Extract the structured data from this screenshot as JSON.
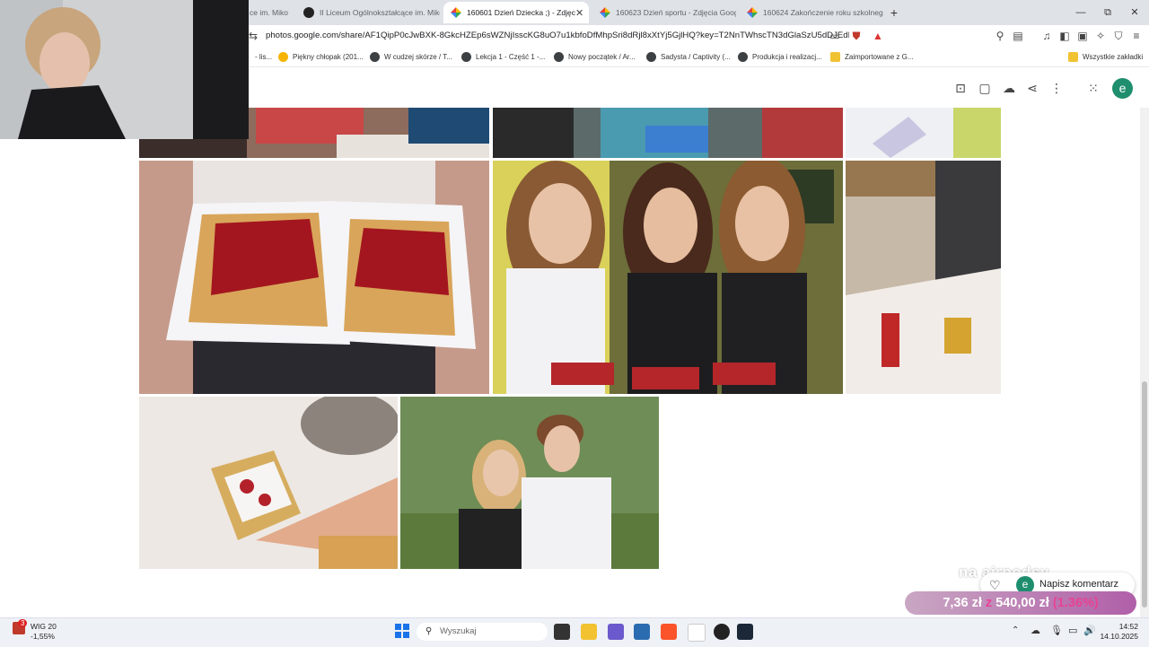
{
  "browser": {
    "tabs": [
      {
        "label": "ce im. Miko",
        "active": false
      },
      {
        "label": "II Liceum Ogólnokształcące im. Miko",
        "active": false
      },
      {
        "label": "160601 Dzień Dziecka ;) - Zdjęc",
        "active": true
      },
      {
        "label": "160623 Dzień sportu - Zdjęcia Goog",
        "active": false
      },
      {
        "label": "160624 Zakończenie roku szkolnego",
        "active": false
      }
    ],
    "new_tab": "+",
    "window_controls": {
      "minimize": "—",
      "restore": "⧉",
      "close": "✕"
    },
    "url": "photos.google.com/share/AF1QipP0cJwBXK-8GkcHZEp6sWZNjIsscKG8uO7u1kbfoDfMhpSri8dRjl8xXtYj5GjlHQ?key=T2NnTWhscTN3dGlaSzU5dDJEdE...",
    "bookmarks": [
      {
        "label": "- lis...",
        "icon": "globe-icon"
      },
      {
        "label": "Piękny chłopak (201...",
        "icon": "smile-icon"
      },
      {
        "label": "W cudzej skórze / T...",
        "icon": "globe-icon"
      },
      {
        "label": "Lekcja 1 - Część 1 -...",
        "icon": "globe-icon"
      },
      {
        "label": "Nowy początek / Ar...",
        "icon": "globe-icon"
      },
      {
        "label": "Sadysta / Captivity (...",
        "icon": "globe-icon"
      },
      {
        "label": "Produkcja i realizacj...",
        "icon": "globe-icon"
      },
      {
        "label": "Zaimportowane z G...",
        "icon": "folder-icon"
      },
      {
        "label": "Wszystkie zakładki",
        "icon": "folder-icon"
      }
    ]
  },
  "photos_header": {
    "icons": [
      "bag-icon",
      "comment-icon",
      "cloud-download-icon",
      "share-icon",
      "more-vert-icon",
      "apps-icon"
    ],
    "avatar": "e"
  },
  "overlay": {
    "text": "na airpodsy",
    "comment_avatar": "e",
    "comment_placeholder": "Napisz komentarz",
    "price_current": "7,36 zł",
    "price_sep": "z",
    "price_target": "540,00 zł",
    "price_percent": "(1.36%)"
  },
  "taskbar": {
    "stock_badge": "3",
    "stock_name": "WIG 20",
    "stock_change": "-1,55%",
    "search_placeholder": "Wyszukaj",
    "time": "14:52",
    "date": "14.10.2025"
  },
  "colors": {
    "accent": "#1e8e6e",
    "tab_bg": "#dfe3e8",
    "price_gradient_end": "#b05fa8"
  }
}
